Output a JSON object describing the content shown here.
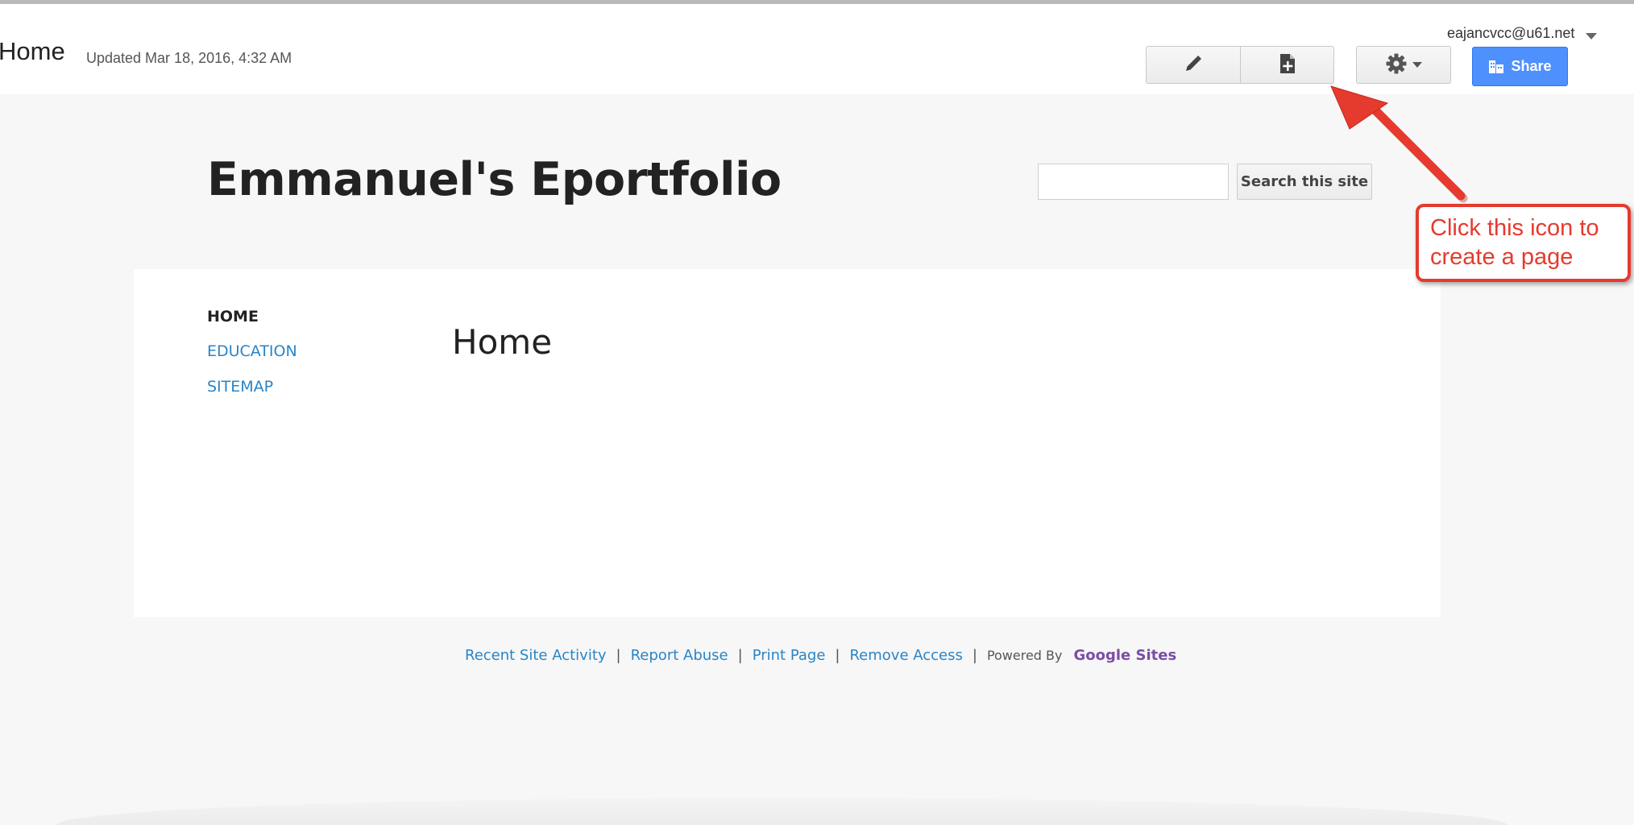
{
  "topbar": {
    "page_name": "Home",
    "updated": "Updated Mar 18, 2016, 4:32 AM",
    "account": "eajancvcc@u61.net",
    "share_label": "Share"
  },
  "site": {
    "title": "Emmanuel's Eportfolio",
    "search_button": "Search this site",
    "search_value": ""
  },
  "nav": {
    "items": [
      {
        "label": "HOME",
        "active": true
      },
      {
        "label": "EDUCATION",
        "active": false
      },
      {
        "label": "SITEMAP",
        "active": false
      }
    ]
  },
  "main": {
    "heading": "Home"
  },
  "footer": {
    "links": [
      "Recent Site Activity",
      "Report Abuse",
      "Print Page",
      "Remove Access"
    ],
    "powered_by": "Powered By",
    "brand": "Google Sites"
  },
  "annotation": {
    "text_line1": "Click this icon to",
    "text_line2": "create a page",
    "color": "#e53a2e"
  },
  "colors": {
    "link": "#2a84c6",
    "share_button": "#4d90fe",
    "brand": "#7b4ea6"
  },
  "icons": {
    "edit": "pencil-icon",
    "new_page": "new-page-icon",
    "settings": "gear-icon",
    "share": "share-icon"
  }
}
